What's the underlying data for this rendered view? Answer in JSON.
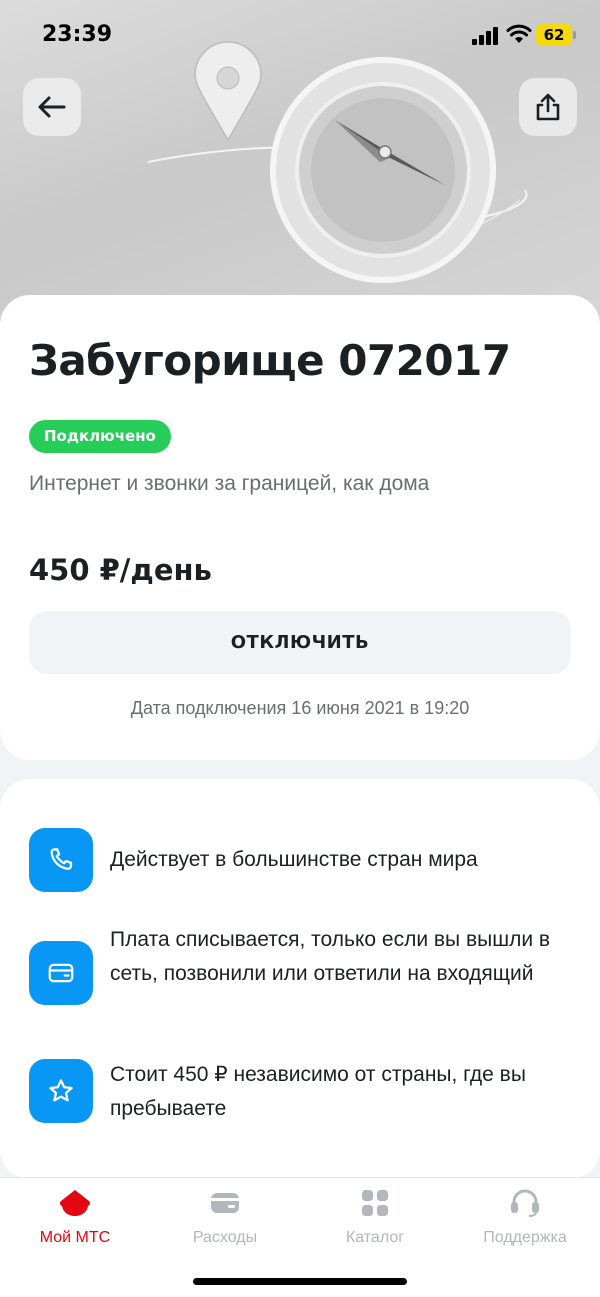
{
  "status_bar": {
    "time": "23:39",
    "battery": "62"
  },
  "header": {
    "back_icon": "arrow-left-icon",
    "share_icon": "share-icon"
  },
  "service": {
    "title": "Забугорище 072017",
    "status_badge": "Подключено",
    "description": "Интернет и звонки за границей, как дома",
    "price": "450 ₽/день",
    "disable_button": "ОТКЛЮЧИТЬ",
    "connection_date": "Дата подключения 16 июня 2021 в 19:20"
  },
  "features": [
    {
      "icon": "phone-icon",
      "text": "Действует в большинстве стран мира"
    },
    {
      "icon": "wallet-icon",
      "text": "Плата списывается, только если вы вышли в сеть, позвонили или ответили на входящий"
    },
    {
      "icon": "star-icon",
      "text": "Стоит 450 ₽ независимо от страны, где вы пребываете"
    }
  ],
  "tabbar": {
    "items": [
      {
        "label": "Мой МТС",
        "icon": "home-icon",
        "active": true
      },
      {
        "label": "Расходы",
        "icon": "wallet-icon",
        "active": false
      },
      {
        "label": "Каталог",
        "icon": "grid-icon",
        "active": false
      },
      {
        "label": "Поддержка",
        "icon": "headset-icon",
        "active": false
      }
    ]
  },
  "colors": {
    "accent": "#E30611",
    "badge_green": "#26CD58",
    "feature_blue": "#0897F5"
  }
}
